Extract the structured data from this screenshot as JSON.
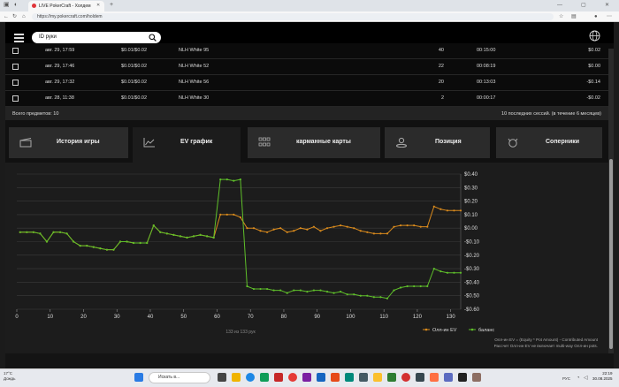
{
  "browser": {
    "tab_title": "LIVE PokerCraft - Холдем",
    "url": "https://my.pokercraft.com/holdem"
  },
  "header": {
    "search_placeholder": "ID руки"
  },
  "sessions": [
    {
      "date": "авг. 29, 17:59",
      "stakes": "$0.01/$0.02",
      "table": "NLH White 95",
      "hands": "40",
      "duration": "00:15:00",
      "result": "$0.02"
    },
    {
      "date": "авг. 29, 17:46",
      "stakes": "$0.01/$0.02",
      "table": "NLH White 52",
      "hands": "22",
      "duration": "00:08:19",
      "result": "$0.00"
    },
    {
      "date": "авг. 29, 17:32",
      "stakes": "$0.01/$0.02",
      "table": "NLH White 56",
      "hands": "20",
      "duration": "00:13:03",
      "result": "-$0.14"
    },
    {
      "date": "авг. 28, 11:38",
      "stakes": "$0.01/$0.02",
      "table": "NLH White 30",
      "hands": "2",
      "duration": "00:00:17",
      "result": "-$0.02"
    }
  ],
  "totals": {
    "left": "Всего предметов: 10",
    "right": "10 последних сессий. (в течение 6 месяцев)"
  },
  "tabs": [
    {
      "label": "История игры",
      "icon": "film-clapper-icon"
    },
    {
      "label": "EV график",
      "icon": "line-chart-icon",
      "active": true
    },
    {
      "label": "карманные карты",
      "icon": "grid-icon"
    },
    {
      "label": "Позиция",
      "icon": "person-position-icon"
    },
    {
      "label": "Соперники",
      "icon": "cat-face-icon"
    }
  ],
  "chart_data": {
    "type": "line",
    "x_ticks": [
      0,
      10,
      20,
      30,
      40,
      50,
      60,
      70,
      80,
      90,
      100,
      110,
      120,
      130
    ],
    "y_ticks": [
      "$0.40",
      "$0.30",
      "$0.20",
      "$0.10",
      "$0.00",
      "-$0.10",
      "-$0.20",
      "-$0.30",
      "-$0.40",
      "-$0.50",
      "-$0.60"
    ],
    "ylim": [
      -0.6,
      0.4
    ],
    "xlim": [
      0,
      133
    ],
    "series": [
      {
        "name": "Олл-ин EV",
        "color": "#d98a1c",
        "points": [
          [
            1,
            -0.03
          ],
          [
            3,
            -0.03
          ],
          [
            5,
            -0.03
          ],
          [
            7,
            -0.04
          ],
          [
            9,
            -0.1
          ],
          [
            11,
            -0.03
          ],
          [
            13,
            -0.03
          ],
          [
            15,
            -0.04
          ],
          [
            17,
            -0.1
          ],
          [
            19,
            -0.13
          ],
          [
            21,
            -0.13
          ],
          [
            23,
            -0.14
          ],
          [
            25,
            -0.15
          ],
          [
            27,
            -0.16
          ],
          [
            29,
            -0.16
          ],
          [
            31,
            -0.1
          ],
          [
            33,
            -0.1
          ],
          [
            35,
            -0.11
          ],
          [
            37,
            -0.11
          ],
          [
            39,
            -0.11
          ],
          [
            41,
            0.02
          ],
          [
            43,
            -0.03
          ],
          [
            45,
            -0.04
          ],
          [
            47,
            -0.05
          ],
          [
            49,
            -0.06
          ],
          [
            51,
            -0.07
          ],
          [
            53,
            -0.06
          ],
          [
            55,
            -0.05
          ],
          [
            57,
            -0.06
          ],
          [
            59,
            -0.07
          ],
          [
            61,
            0.1
          ],
          [
            63,
            0.1
          ],
          [
            65,
            0.1
          ],
          [
            67,
            0.08
          ],
          [
            69,
            0.0
          ],
          [
            71,
            0.0
          ],
          [
            73,
            -0.02
          ],
          [
            75,
            -0.03
          ],
          [
            77,
            -0.01
          ],
          [
            79,
            0.0
          ],
          [
            81,
            -0.03
          ],
          [
            83,
            -0.02
          ],
          [
            85,
            0.0
          ],
          [
            87,
            -0.01
          ],
          [
            89,
            0.01
          ],
          [
            91,
            -0.02
          ],
          [
            93,
            0.0
          ],
          [
            95,
            0.01
          ],
          [
            97,
            0.02
          ],
          [
            99,
            0.01
          ],
          [
            101,
            0.0
          ],
          [
            103,
            -0.02
          ],
          [
            105,
            -0.03
          ],
          [
            107,
            -0.04
          ],
          [
            109,
            -0.04
          ],
          [
            111,
            -0.04
          ],
          [
            113,
            0.01
          ],
          [
            115,
            0.02
          ],
          [
            117,
            0.02
          ],
          [
            119,
            0.02
          ],
          [
            121,
            0.01
          ],
          [
            123,
            0.01
          ],
          [
            125,
            0.16
          ],
          [
            127,
            0.14
          ],
          [
            129,
            0.13
          ],
          [
            131,
            0.13
          ],
          [
            133,
            0.13
          ]
        ]
      },
      {
        "name": "баланс",
        "color": "#5fbf2a",
        "points": [
          [
            1,
            -0.03
          ],
          [
            3,
            -0.03
          ],
          [
            5,
            -0.03
          ],
          [
            7,
            -0.04
          ],
          [
            9,
            -0.1
          ],
          [
            11,
            -0.03
          ],
          [
            13,
            -0.03
          ],
          [
            15,
            -0.04
          ],
          [
            17,
            -0.1
          ],
          [
            19,
            -0.13
          ],
          [
            21,
            -0.13
          ],
          [
            23,
            -0.14
          ],
          [
            25,
            -0.15
          ],
          [
            27,
            -0.16
          ],
          [
            29,
            -0.16
          ],
          [
            31,
            -0.1
          ],
          [
            33,
            -0.1
          ],
          [
            35,
            -0.11
          ],
          [
            37,
            -0.11
          ],
          [
            39,
            -0.11
          ],
          [
            41,
            0.02
          ],
          [
            43,
            -0.03
          ],
          [
            45,
            -0.04
          ],
          [
            47,
            -0.05
          ],
          [
            49,
            -0.06
          ],
          [
            51,
            -0.07
          ],
          [
            53,
            -0.06
          ],
          [
            55,
            -0.05
          ],
          [
            57,
            -0.06
          ],
          [
            59,
            -0.07
          ],
          [
            61,
            0.36
          ],
          [
            63,
            0.36
          ],
          [
            65,
            0.35
          ],
          [
            67,
            0.36
          ],
          [
            69,
            -0.43
          ],
          [
            71,
            -0.45
          ],
          [
            73,
            -0.45
          ],
          [
            75,
            -0.45
          ],
          [
            77,
            -0.46
          ],
          [
            79,
            -0.46
          ],
          [
            81,
            -0.48
          ],
          [
            83,
            -0.46
          ],
          [
            85,
            -0.46
          ],
          [
            87,
            -0.47
          ],
          [
            89,
            -0.46
          ],
          [
            91,
            -0.46
          ],
          [
            93,
            -0.47
          ],
          [
            95,
            -0.48
          ],
          [
            97,
            -0.47
          ],
          [
            99,
            -0.49
          ],
          [
            101,
            -0.49
          ],
          [
            103,
            -0.5
          ],
          [
            105,
            -0.5
          ],
          [
            107,
            -0.51
          ],
          [
            109,
            -0.51
          ],
          [
            111,
            -0.52
          ],
          [
            113,
            -0.46
          ],
          [
            115,
            -0.44
          ],
          [
            117,
            -0.43
          ],
          [
            119,
            -0.43
          ],
          [
            121,
            -0.43
          ],
          [
            123,
            -0.43
          ],
          [
            125,
            -0.3
          ],
          [
            127,
            -0.32
          ],
          [
            129,
            -0.33
          ],
          [
            131,
            -0.33
          ],
          [
            133,
            -0.33
          ]
        ]
      }
    ],
    "hands_label": "133 из 133 рук",
    "note_line1": "Олл-ин EV = (Equity * Pot Amount) - Contributed Amount",
    "note_line2": "Рассчет Олл-ин EV не включает multi-way Олл-ин pots."
  },
  "taskbar": {
    "weather_temp": "17°C",
    "weather_desc": "Дождь",
    "search_placeholder": "Искать в...",
    "lang": "РУС",
    "time": "22:19",
    "date": "30.08.2025"
  }
}
